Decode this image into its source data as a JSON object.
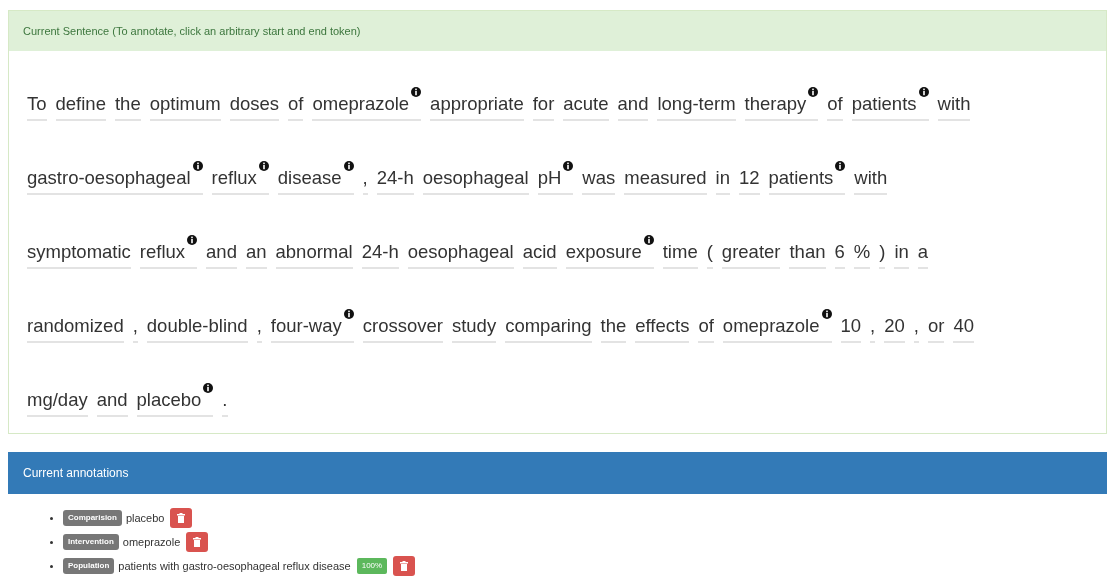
{
  "sentence_panel": {
    "heading": "Current Sentence (To annotate, click an arbitrary start and end token)",
    "lines": [
      [
        {
          "text": "To",
          "info": false
        },
        {
          "text": "define",
          "info": false
        },
        {
          "text": "the",
          "info": false
        },
        {
          "text": "optimum",
          "info": false
        },
        {
          "text": "doses",
          "info": false
        },
        {
          "text": "of",
          "info": false
        },
        {
          "text": "omeprazole",
          "info": true
        },
        {
          "text": "appropriate",
          "info": false
        },
        {
          "text": "for",
          "info": false
        },
        {
          "text": "acute",
          "info": false
        },
        {
          "text": "and",
          "info": false
        },
        {
          "text": "long-term",
          "info": false
        },
        {
          "text": "therapy",
          "info": true
        },
        {
          "text": "of",
          "info": false
        },
        {
          "text": "patients",
          "info": true
        },
        {
          "text": "with",
          "info": false
        }
      ],
      [
        {
          "text": "gastro-oesophageal",
          "info": true
        },
        {
          "text": "reflux",
          "info": true
        },
        {
          "text": "disease",
          "info": true
        },
        {
          "text": ",",
          "info": false
        },
        {
          "text": "24-h",
          "info": false
        },
        {
          "text": "oesophageal",
          "info": false
        },
        {
          "text": "pH",
          "info": true
        },
        {
          "text": "was",
          "info": false
        },
        {
          "text": "measured",
          "info": false
        },
        {
          "text": "in",
          "info": false
        },
        {
          "text": "12",
          "info": false
        },
        {
          "text": "patients",
          "info": true
        },
        {
          "text": "with",
          "info": false
        }
      ],
      [
        {
          "text": "symptomatic",
          "info": false
        },
        {
          "text": "reflux",
          "info": true
        },
        {
          "text": "and",
          "info": false
        },
        {
          "text": "an",
          "info": false
        },
        {
          "text": "abnormal",
          "info": false
        },
        {
          "text": "24-h",
          "info": false
        },
        {
          "text": "oesophageal",
          "info": false
        },
        {
          "text": "acid",
          "info": false
        },
        {
          "text": "exposure",
          "info": true
        },
        {
          "text": "time",
          "info": false
        },
        {
          "text": "(",
          "info": false
        },
        {
          "text": "greater",
          "info": false
        },
        {
          "text": "than",
          "info": false
        },
        {
          "text": "6",
          "info": false
        },
        {
          "text": "%",
          "info": false
        },
        {
          "text": ")",
          "info": false
        },
        {
          "text": "in",
          "info": false
        },
        {
          "text": "a",
          "info": false
        }
      ],
      [
        {
          "text": "randomized",
          "info": false
        },
        {
          "text": ",",
          "info": false
        },
        {
          "text": "double-blind",
          "info": false
        },
        {
          "text": ",",
          "info": false
        },
        {
          "text": "four-way",
          "info": true
        },
        {
          "text": "crossover",
          "info": false
        },
        {
          "text": "study",
          "info": false
        },
        {
          "text": "comparing",
          "info": false
        },
        {
          "text": "the",
          "info": false
        },
        {
          "text": "effects",
          "info": false
        },
        {
          "text": "of",
          "info": false
        },
        {
          "text": "omeprazole",
          "info": true
        },
        {
          "text": "10",
          "info": false
        },
        {
          "text": ",",
          "info": false
        },
        {
          "text": "20",
          "info": false
        },
        {
          "text": ",",
          "info": false
        },
        {
          "text": "or",
          "info": false
        },
        {
          "text": "40",
          "info": false
        }
      ],
      [
        {
          "text": "mg/day",
          "info": false
        },
        {
          "text": "and",
          "info": false
        },
        {
          "text": "placebo",
          "info": true
        },
        {
          "text": ".",
          "info": false
        }
      ]
    ]
  },
  "annotations_panel": {
    "heading": "Current annotations",
    "items": [
      {
        "label": "Comparision",
        "text": "placebo"
      },
      {
        "label": "Intervention",
        "text": "omeprazole"
      },
      {
        "label": "Population",
        "text": "patients with gastro-oesophageal reflux disease",
        "score": "100%"
      }
    ]
  }
}
